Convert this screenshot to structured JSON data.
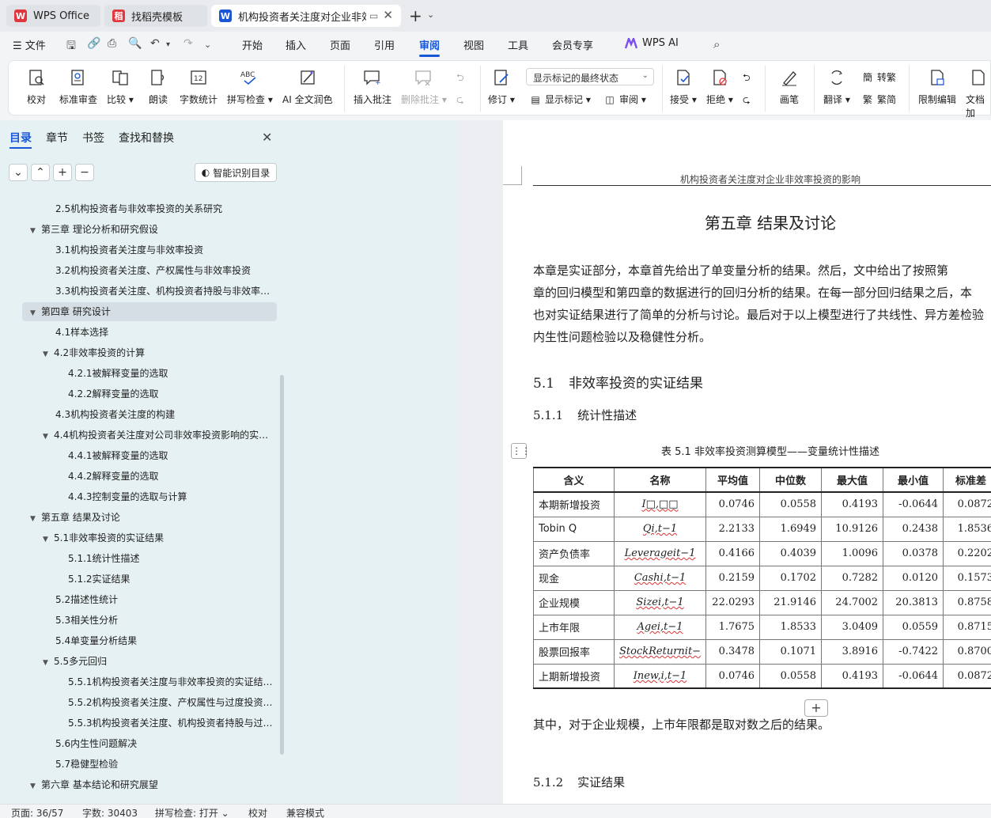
{
  "titlebar": {
    "tabs": [
      {
        "label": "WPS Office",
        "logo": "W"
      },
      {
        "label": "找稻壳模板",
        "logo": "稻"
      },
      {
        "label": "机构投资者关注度对企业非效率投资的影响",
        "logo": "W"
      }
    ],
    "new_tab": "+",
    "dropdown": "⌄",
    "close": "✕"
  },
  "menubar": {
    "file": "文件",
    "items": [
      "开始",
      "插入",
      "页面",
      "引用",
      "审阅",
      "视图",
      "工具",
      "会员专享",
      "WPS AI"
    ],
    "active": "审阅"
  },
  "ribbon": {
    "proofread": "校对",
    "standard_review": "标准审查",
    "compare": "比较",
    "read_aloud": "朗读",
    "word_count": "字数统计",
    "spell_check": "拼写检查",
    "ai_polish": "AI 全文润色",
    "insert_comment": "插入批注",
    "delete_comment": "删除批注",
    "track_changes": "修订",
    "markup_mode": "显示标记的最终状态",
    "show_markup": "显示标记",
    "review": "审阅",
    "accept": "接受",
    "reject": "拒绝",
    "pen": "画笔",
    "translate": "翻译",
    "to_traditional": "转繁",
    "to_simplified": "繁简",
    "restrict_edit": "限制编辑",
    "doc_encrypt": "文档加"
  },
  "nav": {
    "tabs": [
      "目录",
      "章节",
      "书签",
      "查找和替换"
    ],
    "smart_toc": "智能识别目录",
    "toc": [
      {
        "level": 2,
        "text": "2.5机构投资者与非效率投资的关系研究",
        "arrow": ""
      },
      {
        "level": 1,
        "text": "第三章  理论分析和研究假设",
        "arrow": "▼"
      },
      {
        "level": 2,
        "text": "3.1机构投资者关注度与非效率投资",
        "arrow": ""
      },
      {
        "level": 2,
        "text": "3.2机构投资者关注度、产权属性与非效率投资",
        "arrow": ""
      },
      {
        "level": 2,
        "text": "3.3机构投资者关注度、机构投资者持股与非效率…",
        "arrow": ""
      },
      {
        "level": 1,
        "text": "第四章  研究设计",
        "arrow": "▼",
        "selected": true
      },
      {
        "level": 2,
        "text": "4.1样本选择",
        "arrow": ""
      },
      {
        "level": 2,
        "text": "4.2非效率投资的计算",
        "arrow": "▼"
      },
      {
        "level": 3,
        "text": "4.2.1被解释变量的选取",
        "arrow": ""
      },
      {
        "level": 3,
        "text": "4.2.2解释变量的选取",
        "arrow": ""
      },
      {
        "level": 2,
        "text": "4.3机构投资者关注度的构建",
        "arrow": ""
      },
      {
        "level": 2,
        "text": "4.4机构投资者关注度对公司非效率投资影响的实…",
        "arrow": "▼"
      },
      {
        "level": 3,
        "text": "4.4.1被解释变量的选取",
        "arrow": ""
      },
      {
        "level": 3,
        "text": "4.4.2解释变量的选取",
        "arrow": ""
      },
      {
        "level": 3,
        "text": "4.4.3控制变量的选取与计算",
        "arrow": ""
      },
      {
        "level": 1,
        "text": "第五章  结果及讨论",
        "arrow": "▼"
      },
      {
        "level": 2,
        "text": "5.1非效率投资的实证结果",
        "arrow": "▼"
      },
      {
        "level": 3,
        "text": "5.1.1统计性描述",
        "arrow": ""
      },
      {
        "level": 3,
        "text": "5.1.2实证结果",
        "arrow": ""
      },
      {
        "level": 2,
        "text": "5.2描述性统计",
        "arrow": ""
      },
      {
        "level": 2,
        "text": "5.3相关性分析",
        "arrow": ""
      },
      {
        "level": 2,
        "text": "5.4单变量分析结果",
        "arrow": ""
      },
      {
        "level": 2,
        "text": "5.5多元回归",
        "arrow": "▼"
      },
      {
        "level": 3,
        "text": "5.5.1机构投资者关注度与非效率投资的实证结…",
        "arrow": ""
      },
      {
        "level": 3,
        "text": "5.5.2机构投资者关注度、产权属性与过度投资…",
        "arrow": ""
      },
      {
        "level": 3,
        "text": "5.5.3机构投资者关注度、机构投资者持股与过…",
        "arrow": ""
      },
      {
        "level": 2,
        "text": "5.6内生性问题解决",
        "arrow": ""
      },
      {
        "level": 2,
        "text": "5.7稳健型检验",
        "arrow": ""
      },
      {
        "level": 1,
        "text": "第六章  基本结论和研究展望",
        "arrow": "▼"
      }
    ]
  },
  "doc": {
    "running_head": "机构投资者关注度对企业非效率投资的影响",
    "chapter_title": "第五章    结果及讨论",
    "intro_lines": [
      "    本章是实证部分，本章首先给出了单变量分析的结果。然后，文中给出了按照第",
      "章的回归模型和第四章的数据进行的回归分析的结果。在每一部分回归结果之后，本",
      "也对实证结果进行了简单的分析与讨论。最后对于以上模型进行了共线性、异方差检验",
      "内生性问题检验以及稳健性分析。"
    ],
    "section_5_1_num": "5.1",
    "section_5_1_title": "非效率投资的实证结果",
    "section_5_1_1_num": "5.1.1",
    "section_5_1_1_title": "统计性描述",
    "table_caption": "表  5.1    非效率投资测算模型——变量统计性描述",
    "table_handle": "⋮⋮",
    "table": {
      "headers": [
        "含义",
        "名称",
        "平均值",
        "中位数",
        "最大值",
        "最小值",
        "标准差"
      ],
      "rows": [
        {
          "label": "本期新增投资",
          "name": "I□,□□",
          "mean": "0.0746",
          "median": "0.0558",
          "max": "0.4193",
          "min": "-0.0644",
          "sd": "0.0872"
        },
        {
          "label": "Tobin Q",
          "name": "Qi,t−1",
          "mean": "2.2133",
          "median": "1.6949",
          "max": "10.9126",
          "min": "0.2438",
          "sd": "1.8536"
        },
        {
          "label": "资产负债率",
          "name": "Leverageit−1",
          "mean": "0.4166",
          "median": "0.4039",
          "max": "1.0096",
          "min": "0.0378",
          "sd": "0.2202"
        },
        {
          "label": "现金",
          "name": "Cashi,t−1",
          "mean": "0.2159",
          "median": "0.1702",
          "max": "0.7282",
          "min": "0.0120",
          "sd": "0.1573"
        },
        {
          "label": "企业规模",
          "name": "Sizei,t−1",
          "mean": "22.0293",
          "median": "21.9146",
          "max": "24.7002",
          "min": "20.3813",
          "sd": "0.8758"
        },
        {
          "label": "上市年限",
          "name": "Agei,t−1",
          "mean": "1.7675",
          "median": "1.8533",
          "max": "3.0409",
          "min": "0.0559",
          "sd": "0.8715"
        },
        {
          "label": "股票回报率",
          "name": "StockReturnit−",
          "mean": "0.3478",
          "median": "0.1071",
          "max": "3.8916",
          "min": "-0.7422",
          "sd": "0.8700"
        },
        {
          "label": "上期新增投资",
          "name": "Inew,i,t−1",
          "mean": "0.0746",
          "median": "0.0558",
          "max": "0.4193",
          "min": "-0.0644",
          "sd": "0.0872"
        }
      ]
    },
    "add_row": "+",
    "after_table": "    其中，对于企业规模，上市年限都是取对数之后的结果。",
    "section_5_1_2_num": "5.1.2",
    "section_5_1_2_title": "实证结果"
  },
  "status": {
    "page": "页面: 36/57",
    "words": "字数: 30403",
    "spell": "拼写检查: 打开",
    "proof": "校对",
    "compat": "兼容模式"
  },
  "colors": {
    "accent": "#1857d6",
    "wps_red": "#e0383e",
    "nav_bg": "#e6f1f3"
  }
}
